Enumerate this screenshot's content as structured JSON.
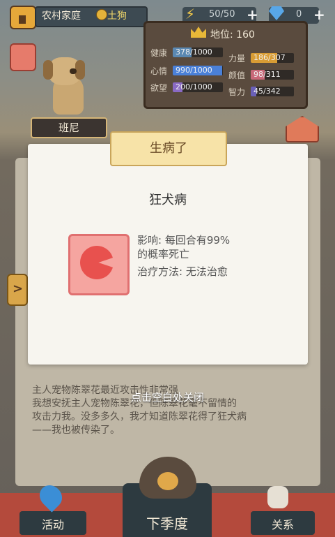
{
  "top": {
    "home_name": "农村家庭",
    "dog_type": "土狗",
    "energy": "50/50",
    "gems": "0",
    "rank_label": "地位: 160"
  },
  "stats": [
    {
      "label": "健康",
      "value": "378/1000",
      "fraction": 0.378,
      "color": "#5a88b2"
    },
    {
      "label": "力量",
      "value": "186/307",
      "fraction": 0.606,
      "color": "#d89c34"
    },
    {
      "label": "心情",
      "value": "990/1000",
      "fraction": 0.99,
      "color": "#4a80d8"
    },
    {
      "label": "颜值",
      "value": "98/311",
      "fraction": 0.315,
      "color": "#c86878"
    },
    {
      "label": "欲望",
      "value": "200/1000",
      "fraction": 0.2,
      "color": "#8a6ac4"
    },
    {
      "label": "智力",
      "value": "45/342",
      "fraction": 0.132,
      "color": "#6a60b8"
    }
  ],
  "dog": {
    "name": "班尼"
  },
  "modal": {
    "title": "生病了",
    "disease": "狂犬病",
    "effect_line1": "影响: 每回合有99%",
    "effect_line2": "的概率死亡",
    "treatment": "治疗方法: 无法治愈"
  },
  "story": {
    "line1": "主人宠物陈翠花最近攻击性非常强",
    "line2": "我想安抚主人宠物陈翠花，但陈翠花毫不留情的",
    "line3": "攻击力我。没多多久，我才知道陈翠花得了狂犬病",
    "line4": "——我也被传染了。"
  },
  "hint": "点击空白处关闭",
  "nav": {
    "activity": "活动",
    "next_season": "下季度",
    "relations": "关系"
  }
}
